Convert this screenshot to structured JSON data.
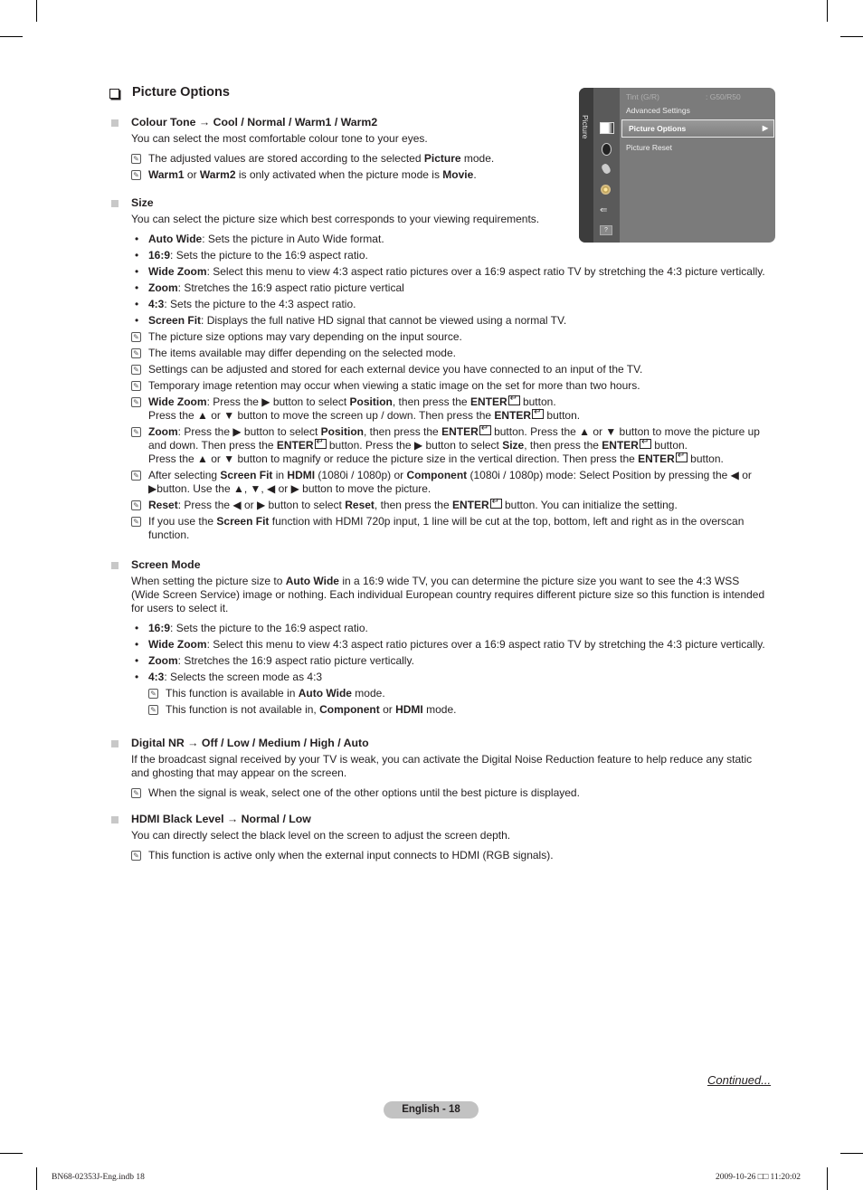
{
  "page": {
    "title": "Picture Options",
    "continued": "Continued...",
    "page_number": "English - 18",
    "footer_left": "BN68-02353J-Eng.indb   18",
    "footer_right": "2009-10-26   □□ 11:20:02"
  },
  "osd": {
    "tab_label": "Picture",
    "icons": [
      "picture-icon",
      "sound-icon",
      "channel-icon",
      "setup-icon",
      "input-icon",
      "support-icon"
    ],
    "rows": [
      {
        "label": "Tint (G/R)",
        "value": ": G50/R50",
        "state": "dim"
      },
      {
        "label": "Advanced Settings",
        "value": "",
        "state": "normal"
      },
      {
        "label": "Picture Options",
        "value": "▶",
        "state": "selected"
      },
      {
        "label": "Picture Reset",
        "value": "",
        "state": "normal"
      }
    ]
  },
  "sections": [
    {
      "head_parts": [
        [
          "Colour Tone",
          1
        ],
        [
          " → ",
          0
        ],
        [
          "Cool",
          1
        ],
        [
          " / ",
          0
        ],
        [
          "Normal",
          1
        ],
        [
          " / ",
          0
        ],
        [
          "Warm1",
          1
        ],
        [
          " / ",
          0
        ],
        [
          "Warm2",
          1
        ]
      ],
      "desc": "You can select the most comfortable colour tone to your eyes.",
      "entries": [
        {
          "t": "note",
          "parts": [
            [
              "The adjusted values are stored according to the selected ",
              0
            ],
            [
              "Picture",
              1
            ],
            [
              " mode.",
              0
            ]
          ]
        },
        {
          "t": "note",
          "parts": [
            [
              "Warm1",
              1
            ],
            [
              " or ",
              0
            ],
            [
              "Warm2",
              1
            ],
            [
              " is only activated when the picture mode is ",
              0
            ],
            [
              "Movie",
              1
            ],
            [
              ".",
              0
            ]
          ]
        }
      ]
    },
    {
      "head_parts": [
        [
          "Size",
          1
        ]
      ],
      "desc": "You can select the picture size which best corresponds to your viewing requirements.",
      "entries": [
        {
          "t": "item",
          "parts": [
            [
              "Auto Wide",
              1
            ],
            [
              ": Sets the picture in Auto Wide format.",
              0
            ]
          ]
        },
        {
          "t": "item",
          "parts": [
            [
              "16:9",
              1
            ],
            [
              ": Sets the picture to the 16:9 aspect ratio.",
              0
            ]
          ]
        },
        {
          "t": "item",
          "parts": [
            [
              "Wide Zoom",
              1
            ],
            [
              ": Select this menu to view 4:3 aspect ratio pictures over a 16:9 aspect ratio TV by stretching the 4:3 picture vertically.",
              0
            ]
          ]
        },
        {
          "t": "item",
          "parts": [
            [
              "Zoom",
              1
            ],
            [
              ": Stretches the 16:9 aspect ratio picture vertical",
              0
            ]
          ]
        },
        {
          "t": "item",
          "parts": [
            [
              "4:3",
              1
            ],
            [
              ": Sets the picture to the 4:3 aspect ratio.",
              0
            ]
          ]
        },
        {
          "t": "item",
          "parts": [
            [
              "Screen Fit",
              1
            ],
            [
              ": Displays the full native HD signal that cannot be viewed using a normal TV.",
              0
            ]
          ]
        },
        {
          "t": "note",
          "parts": [
            [
              "The picture size options  may vary depending on the input source.",
              0
            ]
          ]
        },
        {
          "t": "note",
          "parts": [
            [
              "The items available may differ depending on the selected mode.",
              0
            ]
          ]
        },
        {
          "t": "note",
          "parts": [
            [
              "Settings can be adjusted and stored for each external device you have connected to an input of the TV.",
              0
            ]
          ]
        },
        {
          "t": "note",
          "parts": [
            [
              "Temporary image retention may occur when viewing a static image on the set for more than two hours.",
              0
            ]
          ]
        },
        {
          "t": "note",
          "parts": [
            [
              "Wide Zoom",
              1
            ],
            [
              ": Press the ▶ button to select ",
              0
            ],
            [
              "Position",
              1
            ],
            [
              ", then press the ",
              0
            ],
            [
              "ENTER",
              1
            ],
            [
              "#E",
              0
            ],
            [
              " button.",
              0
            ],
            [
              "#BR",
              0
            ],
            [
              "Press the ▲ or ▼ button to move the screen up / down. Then press the ",
              0
            ],
            [
              "ENTER",
              1
            ],
            [
              "#E",
              0
            ],
            [
              " button.",
              0
            ]
          ]
        },
        {
          "t": "note",
          "parts": [
            [
              "Zoom",
              1
            ],
            [
              ": Press the ▶ button to select ",
              0
            ],
            [
              "Position",
              1
            ],
            [
              ", then press the ",
              0
            ],
            [
              "ENTER",
              1
            ],
            [
              "#E",
              0
            ],
            [
              " button. Press the ▲ or ▼ button to move the picture up and down. Then press the ",
              0
            ],
            [
              "ENTER",
              1
            ],
            [
              "#E",
              0
            ],
            [
              " button. Press the ▶ button to select ",
              0
            ],
            [
              "Size",
              1
            ],
            [
              ", then press the ",
              0
            ],
            [
              "ENTER",
              1
            ],
            [
              "#E",
              0
            ],
            [
              " button.",
              0
            ],
            [
              "#BR",
              0
            ],
            [
              "Press the ▲ or ▼ button to magnify or reduce the picture size in the vertical direction. Then press the ",
              0
            ],
            [
              "ENTER",
              1
            ],
            [
              "#E",
              0
            ],
            [
              " button.",
              0
            ]
          ]
        },
        {
          "t": "note",
          "parts": [
            [
              "After selecting ",
              0
            ],
            [
              "Screen Fit",
              1
            ],
            [
              " in ",
              0
            ],
            [
              "HDMI",
              1
            ],
            [
              " (1080i / 1080p) or ",
              0
            ],
            [
              "Component",
              1
            ],
            [
              " (1080i / 1080p) mode: Select Position by pressing the ◀ or ▶button. Use the ▲, ▼, ◀ or ▶ button to move the picture.",
              0
            ]
          ]
        },
        {
          "t": "note",
          "parts": [
            [
              "Reset",
              1
            ],
            [
              ": Press the ◀ or ▶ button to select ",
              0
            ],
            [
              "Reset",
              1
            ],
            [
              ", then press the ",
              0
            ],
            [
              "ENTER",
              1
            ],
            [
              "#E",
              0
            ],
            [
              " button. You can initialize the setting.",
              0
            ]
          ]
        },
        {
          "t": "note",
          "parts": [
            [
              "If you use the ",
              0
            ],
            [
              "Screen Fit",
              1
            ],
            [
              " function with HDMI 720p input, 1 line will be cut at the top, bottom, left and right as in the overscan function.",
              0
            ]
          ]
        }
      ]
    },
    {
      "head_parts": [
        [
          "Screen Mode",
          1
        ]
      ],
      "desc_parts": [
        [
          "When setting the picture size to ",
          0
        ],
        [
          "Auto Wide",
          1
        ],
        [
          " in a 16:9 wide TV, you can determine the picture size you want to see the 4:3 WSS (Wide Screen Service) image or nothing. Each individual European country requires different picture size so this function is intended for users to select it.",
          0
        ]
      ],
      "entries": [
        {
          "t": "item",
          "parts": [
            [
              "16:9",
              1
            ],
            [
              ": Sets the picture to the 16:9 aspect ratio.",
              0
            ]
          ]
        },
        {
          "t": "item",
          "parts": [
            [
              "Wide Zoom",
              1
            ],
            [
              ": Select this menu to view 4:3 aspect ratio pictures over a 16:9 aspect ratio TV by stretching the 4:3 picture vertically.",
              0
            ]
          ]
        },
        {
          "t": "item",
          "parts": [
            [
              "Zoom",
              1
            ],
            [
              ": Stretches the 16:9 aspect ratio picture vertically.",
              0
            ]
          ]
        },
        {
          "t": "item",
          "parts": [
            [
              "4:3",
              1
            ],
            [
              ": Selects the screen mode as 4:3",
              0
            ]
          ]
        },
        {
          "t": "subnote",
          "parts": [
            [
              "This function is available in ",
              0
            ],
            [
              "Auto Wide",
              1
            ],
            [
              " mode.",
              0
            ]
          ]
        },
        {
          "t": "subnote",
          "parts": [
            [
              "This function is not available in, ",
              0
            ],
            [
              "Component",
              1
            ],
            [
              " or ",
              0
            ],
            [
              "HDMI",
              1
            ],
            [
              " mode.",
              0
            ]
          ]
        }
      ]
    },
    {
      "head_parts": [
        [
          "Digital NR",
          1
        ],
        [
          " → ",
          0
        ],
        [
          "Off",
          1
        ],
        [
          " / ",
          0
        ],
        [
          "Low",
          1
        ],
        [
          " / ",
          0
        ],
        [
          "Medium",
          1
        ],
        [
          " / ",
          0
        ],
        [
          "High",
          1
        ],
        [
          " / ",
          0
        ],
        [
          "Auto",
          1
        ]
      ],
      "desc": "If the broadcast signal received by your TV is weak, you can activate the Digital Noise Reduction feature to help reduce any static and ghosting that may appear on the screen.",
      "entries": [
        {
          "t": "note",
          "parts": [
            [
              "When the signal is weak, select one of the other options until the best picture is displayed.",
              0
            ]
          ]
        }
      ]
    },
    {
      "head_parts": [
        [
          "HDMI Black Level",
          1
        ],
        [
          " → ",
          0
        ],
        [
          "Normal",
          1
        ],
        [
          " / ",
          0
        ],
        [
          "Low",
          1
        ]
      ],
      "desc": "You can directly select the black level on the screen to adjust the screen depth.",
      "entries": [
        {
          "t": "note",
          "parts": [
            [
              "This function is active only when the external input connects to HDMI (RGB signals).",
              0
            ]
          ]
        }
      ]
    }
  ]
}
